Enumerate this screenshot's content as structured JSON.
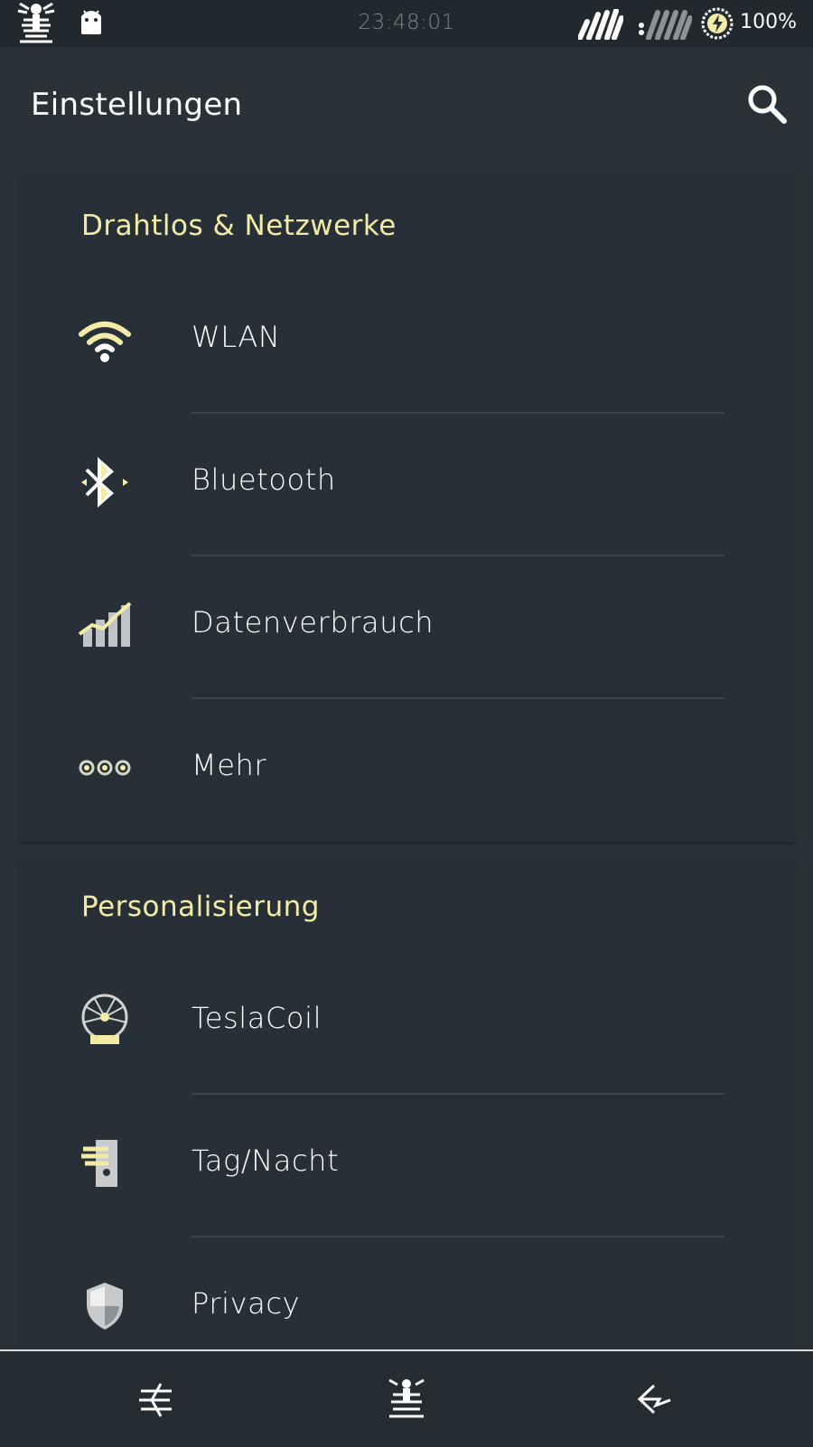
{
  "status_bar": {
    "time": "23:48:01",
    "battery": "100%",
    "icons": [
      "tesla-coil-icon",
      "android-icon",
      "signal-strength-icon",
      "signal-strength-2-icon",
      "battery-charging-icon"
    ]
  },
  "app_bar": {
    "title": "Einstellungen",
    "search_icon": "search-icon"
  },
  "sections": [
    {
      "title": "Drahtlos & Netzwerke",
      "items": [
        {
          "label": "WLAN",
          "icon": "wifi-icon"
        },
        {
          "label": "Bluetooth",
          "icon": "bluetooth-icon"
        },
        {
          "label": "Datenverbrauch",
          "icon": "data-usage-icon"
        },
        {
          "label": "Mehr",
          "icon": "more-icon"
        }
      ]
    },
    {
      "title": "Personalisierung",
      "items": [
        {
          "label": "TeslaCoil",
          "icon": "tesla-coil-icon"
        },
        {
          "label": "Tag/Nacht",
          "icon": "day-night-icon"
        },
        {
          "label": "Privacy",
          "icon": "shield-icon"
        }
      ]
    }
  ],
  "nav_bar": {
    "icons": [
      "menu-icon",
      "home-icon",
      "back-icon"
    ]
  },
  "colors": {
    "accent": "#f4eba6",
    "background": "#2a3237",
    "card": "#263036",
    "status_bar": "#22292e"
  }
}
